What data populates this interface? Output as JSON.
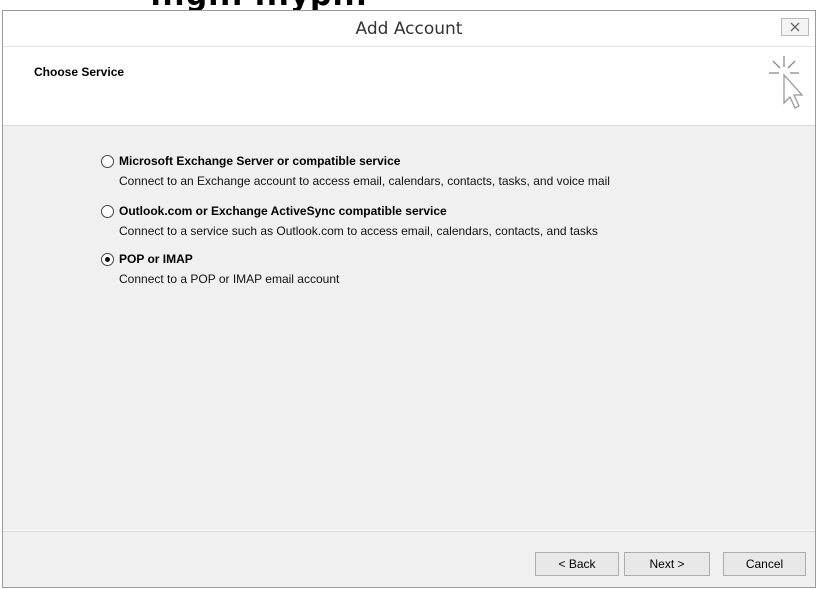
{
  "top_heading": "...g... ...yp...",
  "dialog": {
    "title": "Add Account",
    "section_title": "Choose Service"
  },
  "options": [
    {
      "label": "Microsoft Exchange Server or compatible service",
      "description": "Connect to an Exchange account to access email, calendars, contacts, tasks, and voice mail",
      "selected": false
    },
    {
      "label": "Outlook.com or Exchange ActiveSync compatible service",
      "description": "Connect to a service such as Outlook.com to access email, calendars, contacts, and tasks",
      "selected": false
    },
    {
      "label": "POP or IMAP",
      "description": "Connect to a POP or IMAP email account",
      "selected": true
    }
  ],
  "buttons": {
    "back": "< Back",
    "next": "Next >",
    "cancel": "Cancel"
  },
  "icons": {
    "close": "close-icon",
    "cursor_graphic": "sparkle-cursor-icon"
  }
}
